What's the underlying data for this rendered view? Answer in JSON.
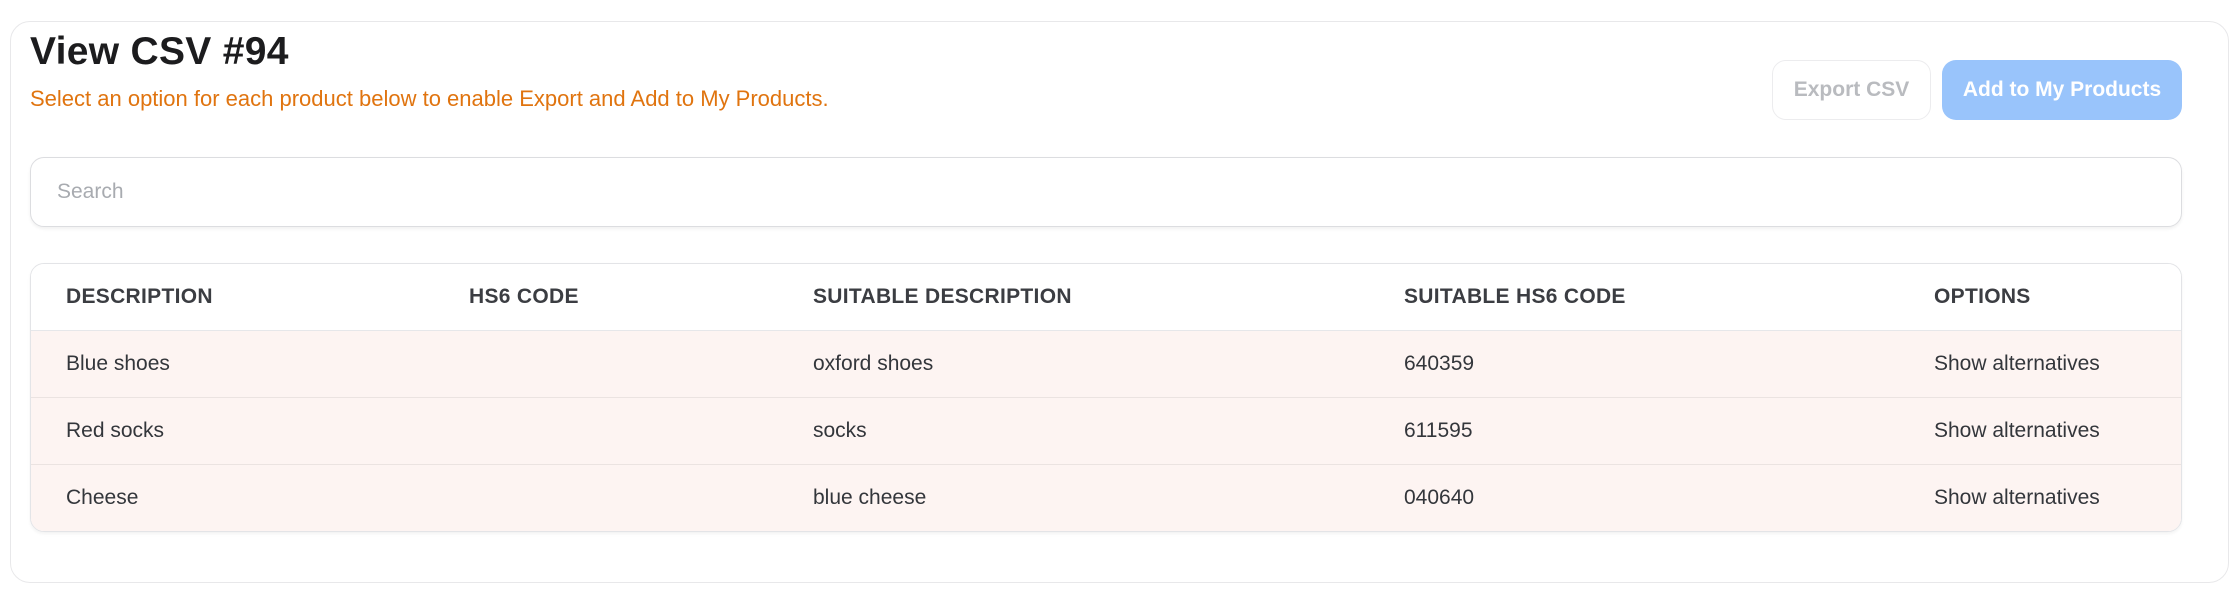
{
  "header": {
    "title": "View CSV #94",
    "subtitle": "Select an option for each product below to enable Export and Add to My Products.",
    "export_label": "Export CSV",
    "add_label": "Add to My Products"
  },
  "search": {
    "placeholder": "Search",
    "value": ""
  },
  "table": {
    "columns": [
      "DESCRIPTION",
      "HS6 CODE",
      "SUITABLE DESCRIPTION",
      "SUITABLE HS6 CODE",
      "OPTIONS"
    ],
    "rows": [
      {
        "description": "Blue shoes",
        "hs6_code": "",
        "suitable_description": "oxford shoes",
        "suitable_hs6_code": "640359",
        "options": "Show alternatives"
      },
      {
        "description": "Red socks",
        "hs6_code": "",
        "suitable_description": "socks",
        "suitable_hs6_code": "611595",
        "options": "Show alternatives"
      },
      {
        "description": "Cheese",
        "hs6_code": "",
        "suitable_description": "blue cheese",
        "suitable_hs6_code": "040640",
        "options": "Show alternatives"
      }
    ]
  },
  "colors": {
    "subtitle": "#e0740f",
    "primary_button_disabled": "#99c4fb",
    "row_highlight": "#fdf4f2"
  }
}
